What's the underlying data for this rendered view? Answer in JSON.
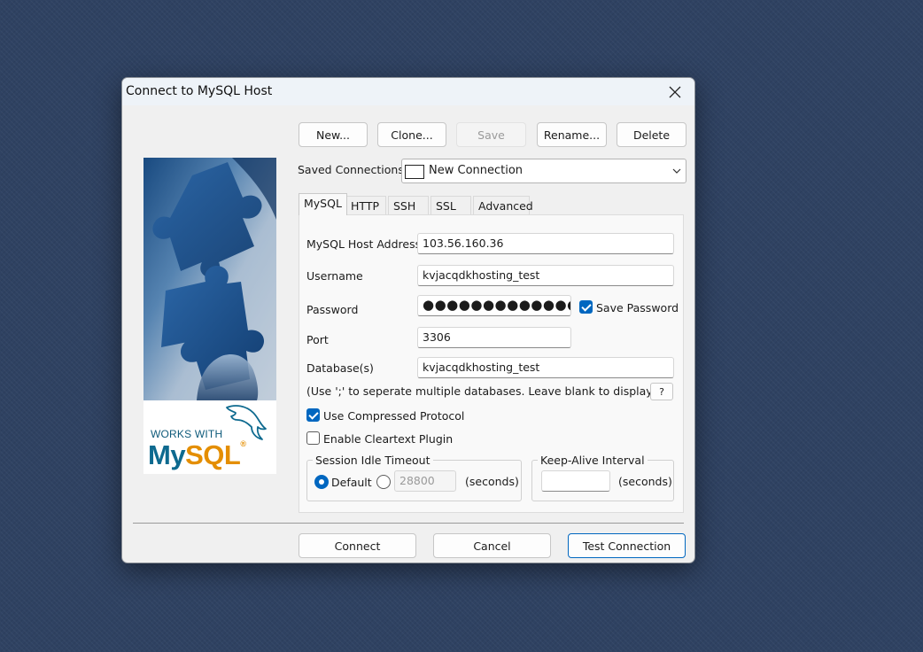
{
  "dialog": {
    "title": "Connect to MySQL Host",
    "close_icon": "close-icon"
  },
  "toolbar": {
    "new_label": "New...",
    "clone_label": "Clone...",
    "save_label": "Save",
    "rename_label": "Rename...",
    "delete_label": "Delete"
  },
  "saved_connections": {
    "label": "Saved Connections",
    "value": "New Connection"
  },
  "logo": {
    "works_with": "WORKS WITH",
    "brand_my": "My",
    "brand_sql": "SQL",
    "registered": "®"
  },
  "tabs": [
    {
      "label": "MySQL",
      "active": true
    },
    {
      "label": "HTTP",
      "active": false
    },
    {
      "label": "SSH",
      "active": false
    },
    {
      "label": "SSL",
      "active": false
    },
    {
      "label": "Advanced",
      "active": false
    }
  ],
  "form": {
    "host_label": "MySQL Host Address",
    "host_value": "103.56.160.36",
    "username_label": "Username",
    "username_value": "kvjacqdkhosting_test",
    "password_label": "Password",
    "password_value": "●●●●●●●●●●●●●●●",
    "save_password_label": "Save Password",
    "save_password_checked": true,
    "port_label": "Port",
    "port_value": "3306",
    "databases_label": "Database(s)",
    "databases_value": "kvjacqdkhosting_test",
    "databases_hint": "(Use ';' to seperate multiple databases. Leave blank to display all)",
    "help_label": "?",
    "compressed_label": "Use Compressed Protocol",
    "compressed_checked": true,
    "cleartext_label": "Enable Cleartext Plugin",
    "cleartext_checked": false
  },
  "session_timeout": {
    "legend": "Session Idle Timeout",
    "default_label": "Default",
    "default_selected": true,
    "custom_value": "28800",
    "seconds_label": "(seconds)"
  },
  "keep_alive": {
    "legend": "Keep-Alive Interval",
    "value": "",
    "seconds_label": "(seconds)"
  },
  "footer": {
    "connect_label": "Connect",
    "cancel_label": "Cancel",
    "test_label": "Test Connection"
  },
  "colors": {
    "accent": "#0067c0",
    "desktop_bg": "#2f4262",
    "mysql_blue": "#0e6a8f",
    "mysql_orange": "#e48e00"
  }
}
